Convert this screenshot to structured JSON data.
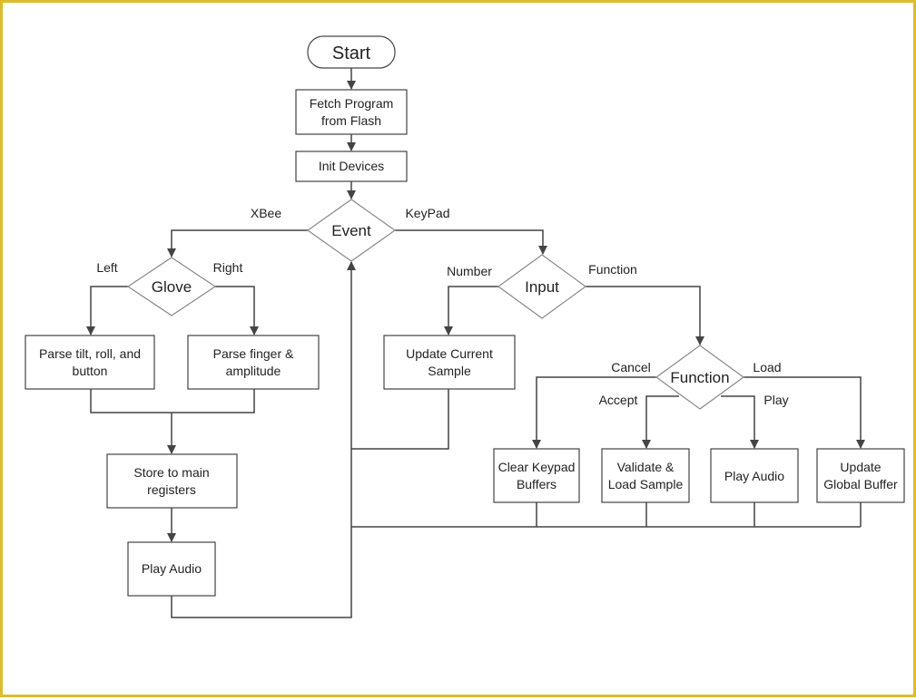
{
  "nodes": {
    "start": "Start",
    "fetch": [
      "Fetch Program",
      "from Flash"
    ],
    "init": "Init Devices",
    "event": "Event",
    "glove": "Glove",
    "input": "Input",
    "parse_tilt": [
      "Parse tilt, roll, and",
      "button"
    ],
    "parse_finger": [
      "Parse finger &",
      "amplitude"
    ],
    "update_current": [
      "Update Current",
      "Sample"
    ],
    "function": "Function",
    "store": [
      "Store to main",
      "registers"
    ],
    "play_audio_left": "Play Audio",
    "clear_keypad": [
      "Clear Keypad",
      "Buffers"
    ],
    "validate": [
      "Validate &",
      "Load Sample"
    ],
    "play_audio_right": "Play Audio",
    "update_global": [
      "Update",
      "Global Buffer"
    ]
  },
  "edge_labels": {
    "xbee": "XBee",
    "keypad": "KeyPad",
    "left": "Left",
    "right": "Right",
    "number": "Number",
    "function": "Function",
    "cancel": "Cancel",
    "load": "Load",
    "accept": "Accept",
    "play": "Play"
  },
  "colors": {
    "border": "#dcbc2c",
    "stroke": "#444444"
  }
}
